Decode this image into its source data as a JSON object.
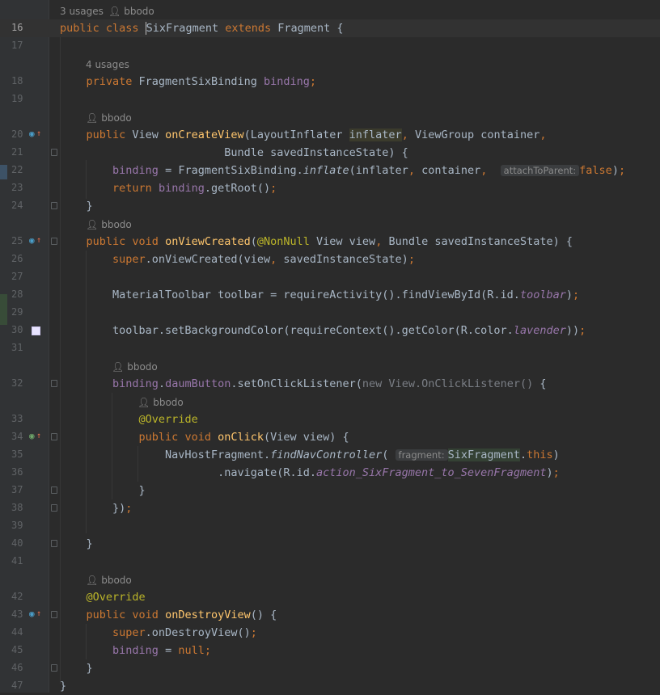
{
  "editor": {
    "language": "Java",
    "current_line": "16",
    "usages_hint": {
      "usages": "3 usages",
      "author": "bbodo",
      "field_usages": "4 usages"
    },
    "author_hint": "bbodo",
    "lines": [
      {
        "n": "16",
        "text": "public class SixFragment extends Fragment {"
      },
      {
        "n": "17",
        "text": ""
      },
      {
        "n": "18",
        "text": "    private FragmentSixBinding binding;"
      },
      {
        "n": "19",
        "text": ""
      },
      {
        "n": "20",
        "text": "    public View onCreateView(LayoutInflater inflater, ViewGroup container,"
      },
      {
        "n": "21",
        "text": "                             Bundle savedInstanceState) {"
      },
      {
        "n": "22",
        "text": "        binding = FragmentSixBinding.inflate(inflater, container,  attachToParent: false);"
      },
      {
        "n": "23",
        "text": "        return binding.getRoot();"
      },
      {
        "n": "24",
        "text": "    }"
      },
      {
        "n": "25",
        "text": "    public void onViewCreated(@NonNull View view, Bundle savedInstanceState) {"
      },
      {
        "n": "26",
        "text": "        super.onViewCreated(view, savedInstanceState);"
      },
      {
        "n": "27",
        "text": ""
      },
      {
        "n": "28",
        "text": "        MaterialToolbar toolbar = requireActivity().findViewById(R.id.toolbar);"
      },
      {
        "n": "29",
        "text": ""
      },
      {
        "n": "30",
        "text": "        toolbar.setBackgroundColor(requireContext().getColor(R.color.lavender));"
      },
      {
        "n": "31",
        "text": ""
      },
      {
        "n": "32",
        "text": "        binding.daumButton.setOnClickListener(new View.OnClickListener() {"
      },
      {
        "n": "33",
        "text": "            @Override"
      },
      {
        "n": "34",
        "text": "            public void onClick(View view) {"
      },
      {
        "n": "35",
        "text": "                NavHostFragment.findNavController( fragment: SixFragment.this)"
      },
      {
        "n": "36",
        "text": "                        .navigate(R.id.action_SixFragment_to_SevenFragment);"
      },
      {
        "n": "37",
        "text": "            }"
      },
      {
        "n": "38",
        "text": "        });"
      },
      {
        "n": "39",
        "text": ""
      },
      {
        "n": "40",
        "text": "    }"
      },
      {
        "n": "41",
        "text": ""
      },
      {
        "n": "42",
        "text": "    @Override"
      },
      {
        "n": "43",
        "text": "    public void onDestroyView() {"
      },
      {
        "n": "44",
        "text": "        super.onDestroyView();"
      },
      {
        "n": "45",
        "text": "        binding = null;"
      },
      {
        "n": "46",
        "text": "    }"
      },
      {
        "n": "47",
        "text": "}"
      }
    ],
    "inlay_hints": {
      "attach_to_parent": "attachToParent:",
      "fragment": "fragment:"
    },
    "colors": {
      "background": "#2b2b2b",
      "keyword": "#cc7832",
      "method": "#ffc66d",
      "field": "#9876aa",
      "annotation": "#bbb529",
      "text": "#a9b7c6",
      "line_number": "#606366",
      "color_swatch_lavender": "#e8e4ff"
    },
    "icons": [
      "person-icon",
      "implements-icon",
      "override-arrow-icon",
      "run-icon",
      "fold-icon",
      "color-swatch-icon"
    ]
  }
}
